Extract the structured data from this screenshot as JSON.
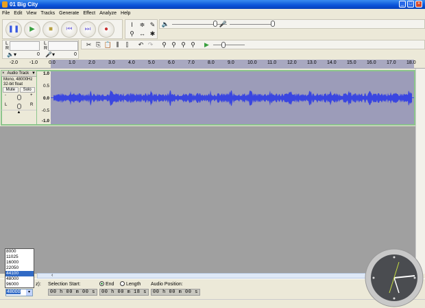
{
  "window": {
    "title": "01 Big City",
    "min": "_",
    "max": "□",
    "close": "×"
  },
  "menu": [
    "File",
    "Edit",
    "View",
    "Tracks",
    "Generate",
    "Effect",
    "Analyze",
    "Help"
  ],
  "transport": {
    "pause": "❚❚",
    "play": "▶",
    "stop": "■",
    "skip_start": "⏮",
    "skip_end": "⏭",
    "record": "●"
  },
  "meters": {
    "left": "L",
    "right": "R",
    "output_icon": "speaker-icon",
    "input_icon": "microphone-icon",
    "zero": "0"
  },
  "ruler": [
    "-2.0",
    "-1.0",
    "0.0",
    "1.0",
    "2.0",
    "3.0",
    "4.0",
    "5.0",
    "6.0",
    "7.0",
    "8.0",
    "9.0",
    "10.0",
    "11.0",
    "12.0",
    "13.0",
    "14.0",
    "15.0",
    "16.0",
    "17.0",
    "18.0"
  ],
  "track": {
    "name": "Audio Track",
    "info1": "Mono, 48000Hz",
    "info2": "32-bit float",
    "mute": "Mute",
    "solo": "Solo",
    "gain_minus": "-",
    "gain_plus": "+",
    "pan_left": "L",
    "pan_right": "R",
    "collapse": "▲",
    "close": "×",
    "yaxis": [
      "1.0",
      "0.5",
      "0.0",
      "-0.5",
      "-1.0"
    ]
  },
  "rate": {
    "label": "Project Rate (Hz):",
    "label_visible": "z):",
    "value": "48000",
    "options": [
      "8000",
      "11025",
      "16000",
      "22050",
      "44100",
      "48000",
      "96000"
    ],
    "highlighted": "44100"
  },
  "selection": {
    "start_label": "Selection Start:",
    "end_label": "End",
    "length_label": "Length",
    "end_selected": true,
    "start": "00 h 00 m 00 s",
    "end": "00 h 00 m 18 s",
    "audio_position_label": "Audio Position:",
    "audio_position": "00 h 00 m 00 s"
  },
  "colors": {
    "wave": "#3a46e0",
    "wave_bg": "#9c9cb9",
    "title": "#0a52d8"
  }
}
